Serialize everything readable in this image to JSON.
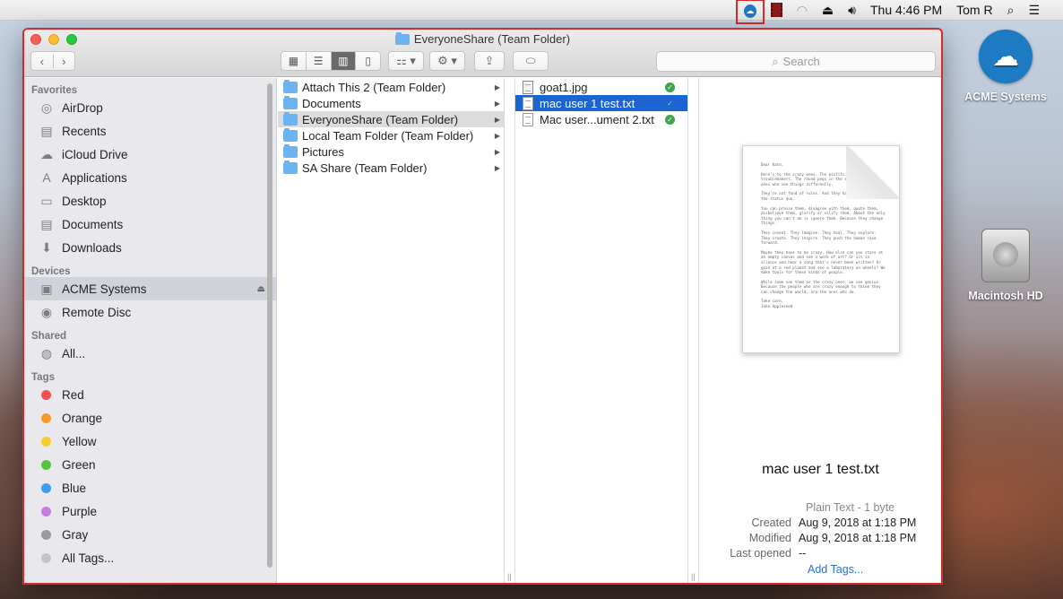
{
  "menubar": {
    "clock": "Thu 4:46 PM",
    "user": "Tom R",
    "icons": [
      "acme-cloud-icon",
      "film-icon",
      "wifi-icon",
      "eject-icon",
      "volume-icon",
      "search-icon",
      "list-icon"
    ]
  },
  "desktop": {
    "acme_label": "ACME Systems",
    "hd_label": "Macintosh HD"
  },
  "window": {
    "title": "EveryoneShare (Team Folder)",
    "search_placeholder": "Search"
  },
  "sidebar": {
    "favorites_header": "Favorites",
    "favorites": [
      {
        "label": "AirDrop",
        "icon": "airdrop-icon"
      },
      {
        "label": "Recents",
        "icon": "recents-icon"
      },
      {
        "label": "iCloud Drive",
        "icon": "cloud-icon"
      },
      {
        "label": "Applications",
        "icon": "applications-icon"
      },
      {
        "label": "Desktop",
        "icon": "desktop-icon"
      },
      {
        "label": "Documents",
        "icon": "documents-icon"
      },
      {
        "label": "Downloads",
        "icon": "downloads-icon"
      }
    ],
    "devices_header": "Devices",
    "devices": [
      {
        "label": "ACME Systems",
        "icon": "drive-icon",
        "selected": true
      },
      {
        "label": "Remote Disc",
        "icon": "disc-icon"
      }
    ],
    "shared_header": "Shared",
    "shared": [
      {
        "label": "All...",
        "icon": "network-icon"
      }
    ],
    "tags_header": "Tags",
    "tags": [
      {
        "label": "Red",
        "color": "#f0524f"
      },
      {
        "label": "Orange",
        "color": "#f79a2e"
      },
      {
        "label": "Yellow",
        "color": "#f5cf2f"
      },
      {
        "label": "Green",
        "color": "#5bc23f"
      },
      {
        "label": "Blue",
        "color": "#3b9cf2"
      },
      {
        "label": "Purple",
        "color": "#c77de0"
      },
      {
        "label": "Gray",
        "color": "#9a9a9a"
      },
      {
        "label": "All Tags..."
      }
    ]
  },
  "column1": [
    {
      "label": "Attach This 2 (Team Folder)"
    },
    {
      "label": "Documents"
    },
    {
      "label": "EveryoneShare (Team Folder)",
      "selected": true
    },
    {
      "label": "Local Team Folder (Team Folder)"
    },
    {
      "label": "Pictures"
    },
    {
      "label": "SA Share (Team Folder)"
    }
  ],
  "column2": [
    {
      "label": "goat1.jpg",
      "type": "image"
    },
    {
      "label": "mac user 1 test.txt",
      "type": "text",
      "selected": true
    },
    {
      "label": "Mac user...ument 2.txt",
      "type": "text"
    }
  ],
  "preview": {
    "filename": "mac user 1 test.txt",
    "kind": "Plain Text - 1 byte",
    "created_label": "Created",
    "created": "Aug 9, 2018 at 1:18 PM",
    "modified_label": "Modified",
    "modified": "Aug 9, 2018 at 1:18 PM",
    "last_opened_label": "Last opened",
    "last_opened": "--",
    "add_tags": "Add Tags...",
    "doc_paragraphs": [
      "Dear Kate,",
      "Here's to the crazy ones. The misfits. The rebels. The troublemakers. The round pegs in the square holes. The ones who see things differently.",
      "They're not fond of rules. And they have no respect for the status quo.",
      "You can praise them, disagree with them, quote them, disbelieve them, glorify or vilify them. About the only thing you can't do is ignore them. Because they change things.",
      "They invent. They imagine. They heal. They explore. They create. They inspire. They push the human race forward.",
      "Maybe they have to be crazy. How else can you stare at an empty canvas and see a work of art? Or sit in silence and hear a song that's never been written? Or gaze at a red planet and see a laboratory on wheels? We make tools for these kinds of people.",
      "While some see them as the crazy ones, we see genius. Because the people who are crazy enough to think they can change the world, are the ones who do.",
      "Take care,\nJohn Appleseed"
    ]
  }
}
